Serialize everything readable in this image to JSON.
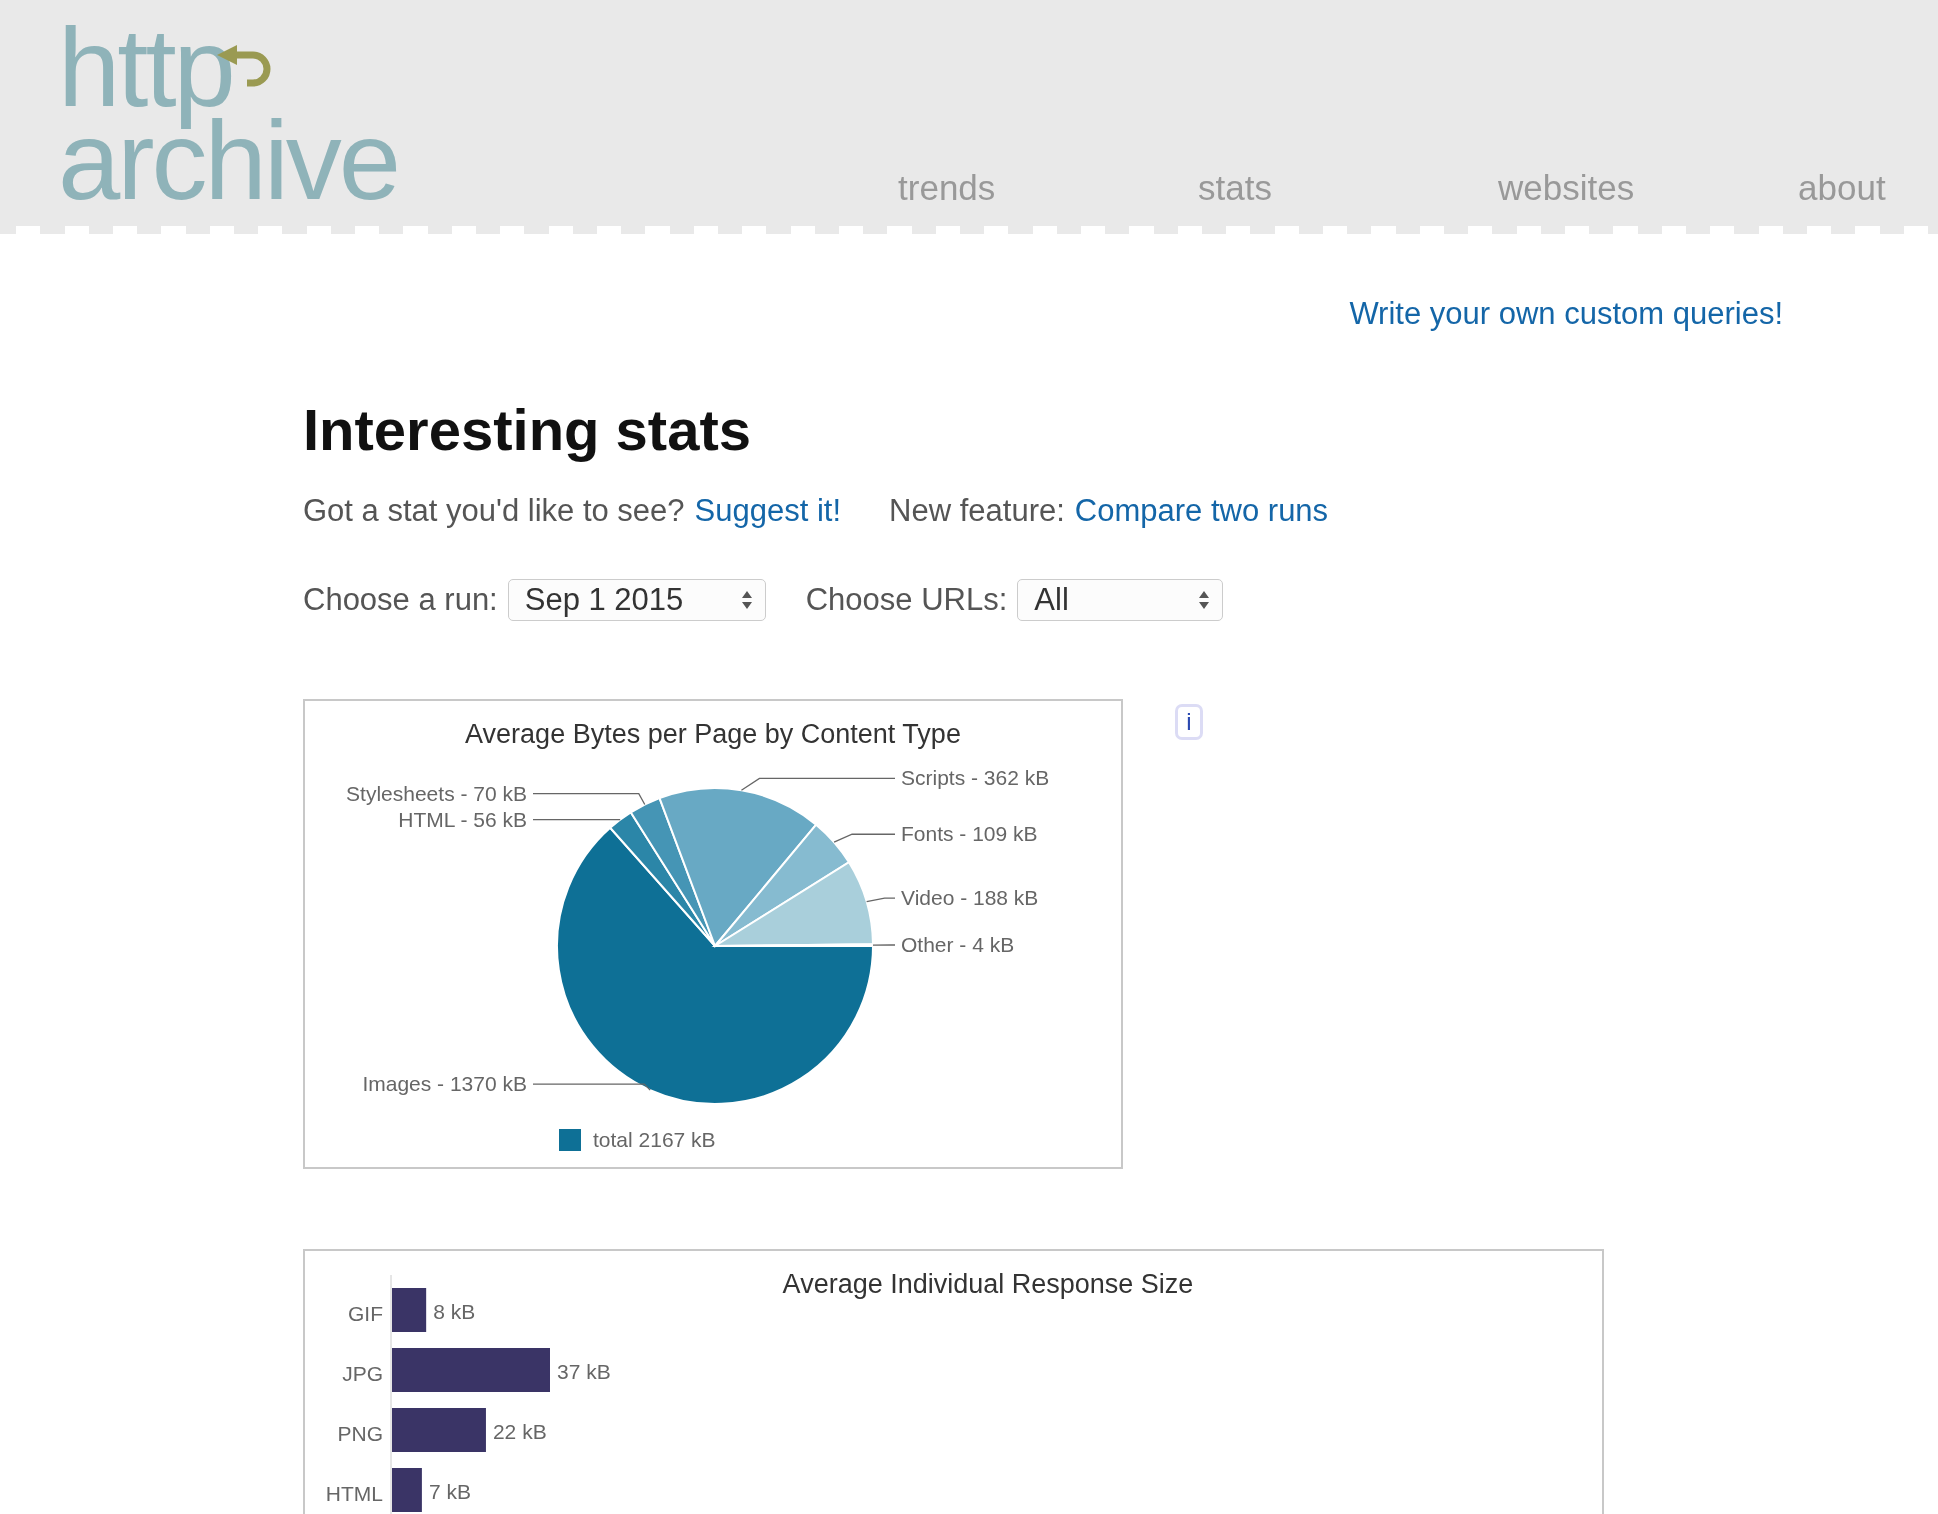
{
  "logo": {
    "line_1": "http",
    "line_2": "archive"
  },
  "nav": [
    {
      "label": "trends"
    },
    {
      "label": "stats"
    },
    {
      "label": "websites"
    },
    {
      "label": "about"
    }
  ],
  "custom_queries_link": "Write your own custom queries!",
  "title": "Interesting stats",
  "intro": {
    "text": "Got a stat you'd like to see?",
    "link": "Suggest it!",
    "feature_text": "New feature:",
    "feature_link": "Compare two runs"
  },
  "controls": [
    {
      "label": "Choose a run:",
      "value": "Sep 1 2015"
    },
    {
      "label": "Choose URLs:",
      "value": "All"
    }
  ],
  "info_button": "i",
  "pie_chart": {
    "chart_data": {
      "type": "pie",
      "title": "Average Bytes per Page by Content Type",
      "categories": [
        "Images",
        "HTML",
        "Stylesheets",
        "Scripts",
        "Fonts",
        "Video",
        "Other"
      ],
      "values": [
        1370,
        56,
        70,
        362,
        109,
        188,
        4
      ],
      "value_labels": [
        "1370 kB",
        "56 kB",
        "70 kB",
        "362 kB",
        "109 kB",
        "188 kB",
        "4 kB"
      ]
    },
    "label_separator": "-",
    "legend": "total 2167 kB"
  },
  "bar_chart": {
    "title": "Average Individual Response Size",
    "chart_data": {
      "type": "bar",
      "orientation": "horizontal",
      "categories": [
        "GIF",
        "JPG",
        "PNG",
        "HTML"
      ],
      "values": [
        8,
        37,
        22,
        7
      ],
      "value_labels": [
        "8 kB",
        "37 kB",
        "22 kB",
        "7 kB"
      ]
    }
  }
}
